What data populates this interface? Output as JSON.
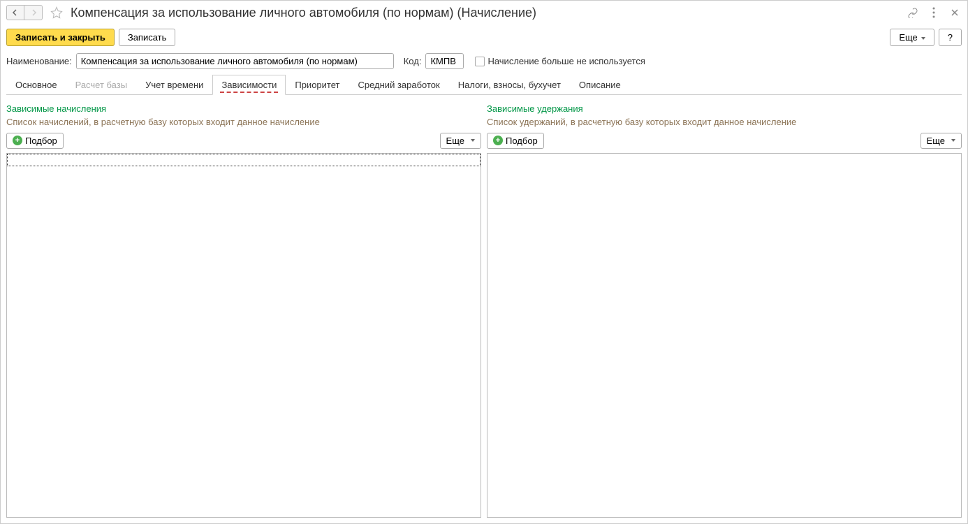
{
  "title": "Компенсация за использование личного автомобиля (по нормам) (Начисление)",
  "toolbar": {
    "save_close": "Записать и закрыть",
    "save": "Записать",
    "more": "Еще",
    "help": "?"
  },
  "form": {
    "name_label": "Наименование:",
    "name_value": "Компенсация за использование личного автомобиля (по нормам)",
    "code_label": "Код:",
    "code_value": "КМПВ",
    "unused_label": "Начисление больше не используется"
  },
  "tabs": [
    {
      "label": "Основное"
    },
    {
      "label": "Расчет базы"
    },
    {
      "label": "Учет времени"
    },
    {
      "label": "Зависимости"
    },
    {
      "label": "Приоритет"
    },
    {
      "label": "Средний заработок"
    },
    {
      "label": "Налоги, взносы, бухучет"
    },
    {
      "label": "Описание"
    }
  ],
  "left": {
    "title": "Зависимые начисления",
    "desc": "Список начислений, в расчетную базу которых входит данное начисление",
    "select": "Подбор",
    "more": "Еще"
  },
  "right": {
    "title": "Зависимые удержания",
    "desc": "Список удержаний, в расчетную базу которых входит данное начисление",
    "select": "Подбор",
    "more": "Еще"
  }
}
